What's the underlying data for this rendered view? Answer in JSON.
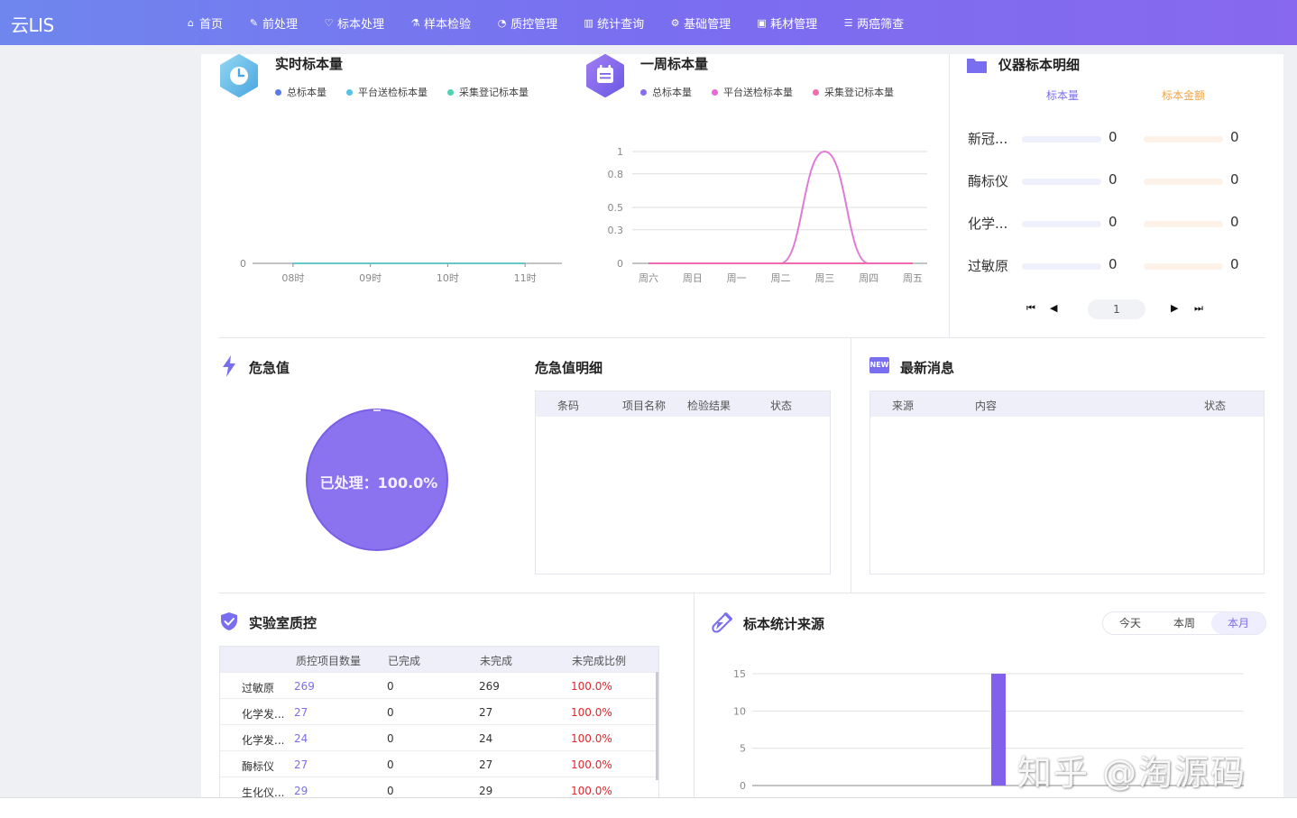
{
  "app": {
    "logo": "云LIS"
  },
  "nav": [
    {
      "label": "首页",
      "icon": "home-icon",
      "glyph": "⌂"
    },
    {
      "label": "前处理",
      "icon": "wrench-icon",
      "glyph": "✎"
    },
    {
      "label": "标本处理",
      "icon": "stethoscope-icon",
      "glyph": "♡"
    },
    {
      "label": "样本检验",
      "icon": "flask-icon",
      "glyph": "⚗"
    },
    {
      "label": "质控管理",
      "icon": "pie-chart-icon",
      "glyph": "◔"
    },
    {
      "label": "统计查询",
      "icon": "bar-chart-icon",
      "glyph": "▥"
    },
    {
      "label": "基础管理",
      "icon": "gear-icon",
      "glyph": "⚙"
    },
    {
      "label": "耗材管理",
      "icon": "briefcase-icon",
      "glyph": "▣"
    },
    {
      "label": "两癌筛查",
      "icon": "list-icon",
      "glyph": "☰"
    }
  ],
  "realtime": {
    "title": "实时标本量",
    "legend": [
      {
        "label": "总标本量",
        "color": "#5b7be6"
      },
      {
        "label": "平台送检标本量",
        "color": "#55c1e6"
      },
      {
        "label": "采集登记标本量",
        "color": "#4fd1b2"
      }
    ]
  },
  "weekly": {
    "title": "一周标本量",
    "legend": [
      {
        "label": "总标本量",
        "color": "#8a6cf0"
      },
      {
        "label": "平台送检标本量",
        "color": "#e56ad7"
      },
      {
        "label": "采集登记标本量",
        "color": "#f06ab0"
      }
    ]
  },
  "instrument": {
    "title": "仪器标本明细",
    "col_count": "标本量",
    "col_amount": "标本金额",
    "rows": [
      {
        "name": "新冠...",
        "count": "0",
        "amount": "0"
      },
      {
        "name": "酶标仪",
        "count": "0",
        "amount": "0"
      },
      {
        "name": "化学...",
        "count": "0",
        "amount": "0"
      },
      {
        "name": "过敏原",
        "count": "0",
        "amount": "0"
      }
    ],
    "page": "1"
  },
  "critical": {
    "title": "危急值",
    "pie_label": "已处理：100.0%",
    "detail_title": "危急值明细",
    "columns": [
      "条码",
      "项目名称",
      "检验结果",
      "状态"
    ]
  },
  "messages": {
    "title": "最新消息",
    "badge": "NEW",
    "columns": [
      "来源",
      "内容",
      "状态"
    ]
  },
  "qc": {
    "title": "实验室质控",
    "columns": [
      "质控项目数量",
      "已完成",
      "未完成",
      "未完成比例"
    ],
    "rows": [
      {
        "name": "过敏原",
        "total": "269",
        "done": "0",
        "undone": "269",
        "ratio": "100.0%"
      },
      {
        "name": "化学发...",
        "total": "27",
        "done": "0",
        "undone": "27",
        "ratio": "100.0%"
      },
      {
        "name": "化学发...",
        "total": "24",
        "done": "0",
        "undone": "24",
        "ratio": "100.0%"
      },
      {
        "name": "酶标仪",
        "total": "27",
        "done": "0",
        "undone": "27",
        "ratio": "100.0%"
      },
      {
        "name": "生化仪...",
        "total": "29",
        "done": "0",
        "undone": "29",
        "ratio": "100.0%"
      }
    ]
  },
  "source": {
    "title": "标本统计来源",
    "tabs": [
      "今天",
      "本周",
      "本月"
    ],
    "active_tab": "本月"
  },
  "watermark": "知乎 @淘源码",
  "colors": {
    "accent": "#7a6ef0",
    "danger": "#e0262b",
    "link": "#7a6ef0",
    "amount_label": "#f0a54a"
  },
  "chart_data": [
    {
      "type": "line",
      "x": [
        "08时",
        "09时",
        "10时",
        "11时"
      ],
      "yticks": [
        0
      ],
      "series": [
        {
          "name": "总标本量",
          "values": [
            0,
            0,
            0,
            0
          ]
        },
        {
          "name": "平台送检标本量",
          "values": [
            0,
            0,
            0,
            0
          ]
        },
        {
          "name": "采集登记标本量",
          "values": [
            0,
            0,
            0,
            0
          ]
        }
      ],
      "ylim": [
        0,
        1
      ]
    },
    {
      "type": "line",
      "x": [
        "周六",
        "周日",
        "周一",
        "周二",
        "周三",
        "周四",
        "周五"
      ],
      "yticks": [
        0,
        0.3,
        0.5,
        0.8,
        1
      ],
      "series": [
        {
          "name": "总标本量",
          "values": [
            0,
            0,
            0,
            0,
            0,
            0,
            0
          ]
        },
        {
          "name": "平台送检标本量",
          "values": [
            0,
            0,
            0,
            0,
            1,
            0,
            0
          ]
        },
        {
          "name": "采集登记标本量",
          "values": [
            0,
            0,
            0,
            0,
            0,
            0,
            0
          ]
        }
      ],
      "ylim": [
        0,
        1
      ]
    },
    {
      "type": "pie",
      "slices": [
        {
          "label": "已处理",
          "value": 100.0
        }
      ]
    },
    {
      "type": "bar",
      "yticks": [
        0,
        5,
        10,
        15
      ],
      "values": [
        15
      ],
      "ylim": [
        0,
        15
      ]
    }
  ]
}
